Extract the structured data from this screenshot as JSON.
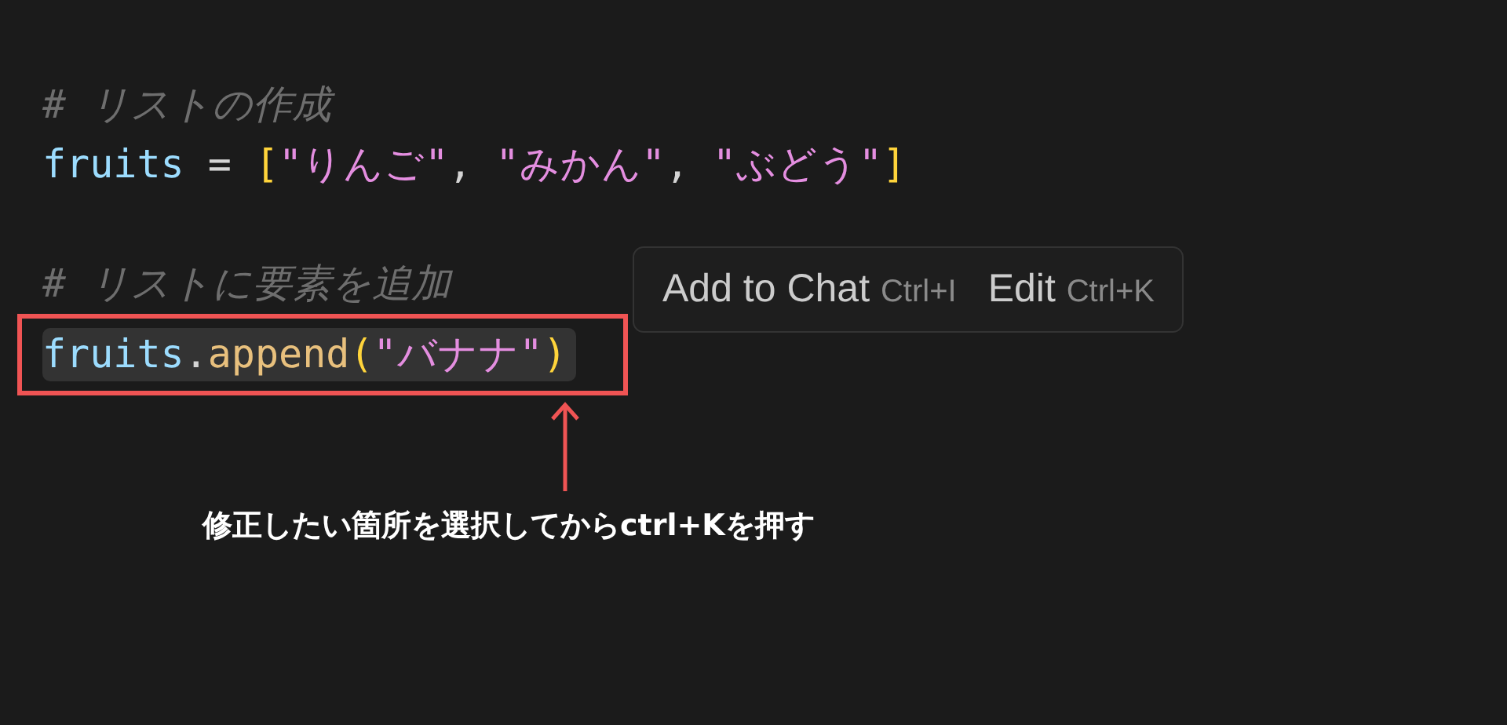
{
  "editor": {
    "lines": [
      {
        "kind": "comment",
        "text": "# リストの作成"
      },
      {
        "kind": "code",
        "selected": false,
        "tokens": [
          {
            "kind": "variable",
            "text": "fruits"
          },
          {
            "kind": "operator",
            "text": " = "
          },
          {
            "kind": "bracket",
            "text": "["
          },
          {
            "kind": "string",
            "text": "\"りんご\""
          },
          {
            "kind": "operator",
            "text": ", "
          },
          {
            "kind": "string",
            "text": "\"みかん\""
          },
          {
            "kind": "operator",
            "text": ", "
          },
          {
            "kind": "string",
            "text": "\"ぶどう\""
          },
          {
            "kind": "bracket",
            "text": "]"
          }
        ]
      },
      {
        "kind": "comment",
        "text": "# リストに要素を追加"
      },
      {
        "kind": "code",
        "selected": true,
        "tokens": [
          {
            "kind": "variable",
            "text": "fruits"
          },
          {
            "kind": "operator",
            "text": "."
          },
          {
            "kind": "function",
            "text": "append"
          },
          {
            "kind": "bracket",
            "text": "("
          },
          {
            "kind": "string",
            "text": "\"バナナ\""
          },
          {
            "kind": "bracket",
            "text": ")"
          }
        ]
      }
    ]
  },
  "popup_menu": {
    "items": [
      {
        "label": "Add to Chat",
        "shortcut": "Ctrl+I"
      },
      {
        "label": "Edit",
        "shortcut": "Ctrl+K"
      }
    ]
  },
  "annotation": {
    "caption": "修正したい箇所を選択してからctrl+Kを押す"
  }
}
